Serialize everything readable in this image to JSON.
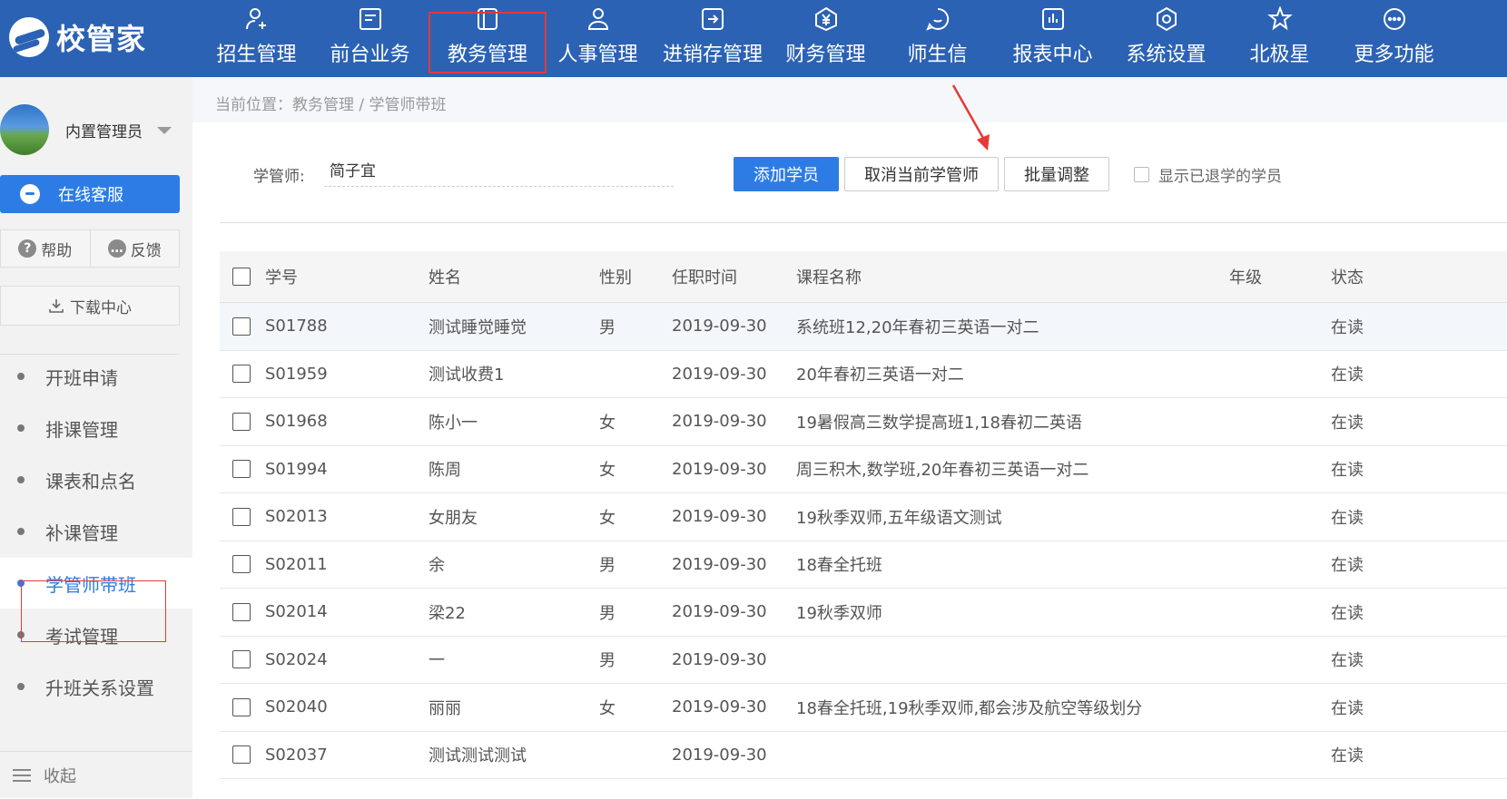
{
  "app": {
    "logo_text": "校管家"
  },
  "nav": {
    "items": [
      {
        "label": "招生管理",
        "icon": "user-add-icon"
      },
      {
        "label": "前台业务",
        "icon": "monitor-icon"
      },
      {
        "label": "教务管理",
        "icon": "book-icon",
        "active": true
      },
      {
        "label": "人事管理",
        "icon": "person-icon"
      },
      {
        "label": "进销存管理",
        "icon": "inventory-icon"
      },
      {
        "label": "财务管理",
        "icon": "yen-icon"
      },
      {
        "label": "师生信",
        "icon": "chat-icon"
      },
      {
        "label": "报表中心",
        "icon": "report-icon"
      },
      {
        "label": "系统设置",
        "icon": "settings-icon"
      },
      {
        "label": "北极星",
        "icon": "star-icon"
      },
      {
        "label": "更多功能",
        "icon": "more-icon"
      }
    ]
  },
  "sidebar": {
    "user_name": "内置管理员",
    "online_service": "在线客服",
    "help": "帮助",
    "feedback": "反馈",
    "download_center": "下载中心",
    "menu": [
      {
        "label": "开班申请"
      },
      {
        "label": "排课管理"
      },
      {
        "label": "课表和点名"
      },
      {
        "label": "补课管理"
      },
      {
        "label": "学管师带班",
        "active": true
      },
      {
        "label": "考试管理"
      },
      {
        "label": "升班关系设置"
      }
    ],
    "collapse": "收起"
  },
  "breadcrumb": "当前位置：教务管理 / 学管师带班",
  "filter": {
    "label": "学管师:",
    "value": "简子宜"
  },
  "toolbar": {
    "add_student": "添加学员",
    "cancel_manager": "取消当前学管师",
    "batch_adjust": "批量调整",
    "show_withdrawn": "显示已退学的学员"
  },
  "table": {
    "headers": {
      "student_no": "学号",
      "name": "姓名",
      "gender": "性别",
      "start_date": "任职时间",
      "course": "课程名称",
      "grade": "年级",
      "status": "状态"
    },
    "rows": [
      {
        "student_no": "S01788",
        "name": "测试睡觉睡觉",
        "gender": "男",
        "start_date": "2019-09-30",
        "course": "系统班12,20年春初三英语一对二",
        "grade": "",
        "status": "在读"
      },
      {
        "student_no": "S01959",
        "name": "测试收费1",
        "gender": "",
        "start_date": "2019-09-30",
        "course": "20年春初三英语一对二",
        "grade": "",
        "status": "在读"
      },
      {
        "student_no": "S01968",
        "name": "陈小一",
        "gender": "女",
        "start_date": "2019-09-30",
        "course": "19暑假高三数学提高班1,18春初二英语",
        "grade": "",
        "status": "在读"
      },
      {
        "student_no": "S01994",
        "name": "陈周",
        "gender": "女",
        "start_date": "2019-09-30",
        "course": "周三积木,数学班,20年春初三英语一对二",
        "grade": "",
        "status": "在读"
      },
      {
        "student_no": "S02013",
        "name": "女朋友",
        "gender": "女",
        "start_date": "2019-09-30",
        "course": "19秋季双师,五年级语文测试",
        "grade": "",
        "status": "在读"
      },
      {
        "student_no": "S02011",
        "name": "余",
        "gender": "男",
        "start_date": "2019-09-30",
        "course": "18春全托班",
        "grade": "",
        "status": "在读"
      },
      {
        "student_no": "S02014",
        "name": "梁22",
        "gender": "男",
        "start_date": "2019-09-30",
        "course": "19秋季双师",
        "grade": "",
        "status": "在读"
      },
      {
        "student_no": "S02024",
        "name": "一",
        "gender": "男",
        "start_date": "2019-09-30",
        "course": "",
        "grade": "",
        "status": "在读"
      },
      {
        "student_no": "S02040",
        "name": "丽丽",
        "gender": "女",
        "start_date": "2019-09-30",
        "course": "18春全托班,19秋季双师,都会涉及航空等级划分",
        "grade": "",
        "status": "在读"
      },
      {
        "student_no": "S02037",
        "name": "测试测试测试",
        "gender": "",
        "start_date": "2019-09-30",
        "course": "",
        "grade": "",
        "status": "在读"
      }
    ]
  },
  "colors": {
    "nav_bg": "#2b62b4",
    "primary": "#2d7ce6",
    "highlight_box": "#e53935"
  }
}
